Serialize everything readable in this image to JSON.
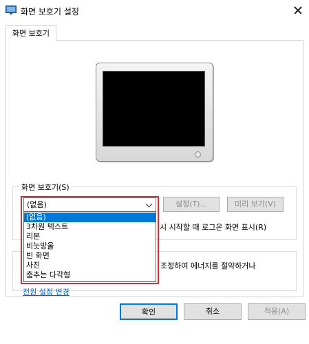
{
  "window": {
    "title": "화면 보호기 설정",
    "icon": "display-settings-icon"
  },
  "tab": {
    "label": "화면 보호기"
  },
  "screensaver": {
    "group_label": "화면 보호기(S)",
    "selected_value": "(없음)",
    "options": [
      "(없음)",
      "3차원 텍스트",
      "리본",
      "비눗방울",
      "빈 화면",
      "사진",
      "춤추는 다각형"
    ],
    "settings_label": "설정(T)...",
    "preview_label": "미리 보기(V)",
    "resume_text_visible": "시 시작할 때 로그온 화면 표시(R)"
  },
  "power": {
    "description_visible": "조정하여 에너지를 절약하거나",
    "link_label": "전원 설정 변경"
  },
  "buttons": {
    "ok": "확인",
    "cancel": "취소",
    "apply": "적용(A)"
  },
  "colors": {
    "accent": "#0078d7",
    "highlight_border": "#d92b3a",
    "link": "#0066cc"
  }
}
